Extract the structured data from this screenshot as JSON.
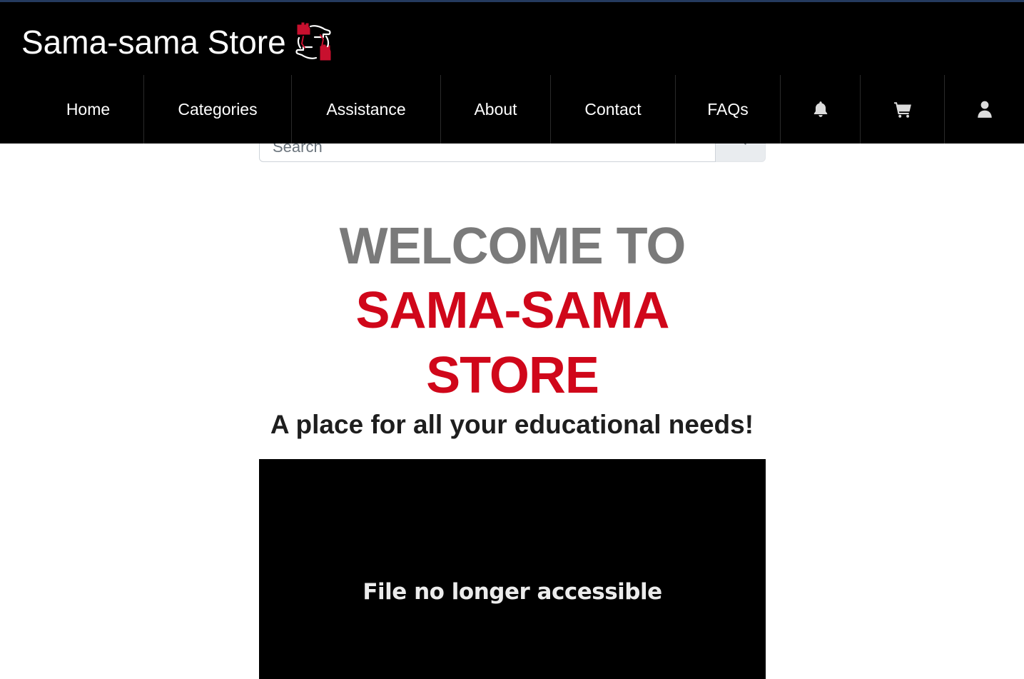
{
  "brand": {
    "name": "Sama-sama Store",
    "logo_icon": "hands-circle-logo-icon"
  },
  "nav": {
    "items": [
      {
        "label": "Home"
      },
      {
        "label": "Categories"
      },
      {
        "label": "Assistance"
      },
      {
        "label": "About"
      },
      {
        "label": "Contact"
      },
      {
        "label": "FAQs"
      }
    ],
    "icons": [
      "bell-icon",
      "cart-icon",
      "user-icon"
    ]
  },
  "search": {
    "placeholder": "Search",
    "button_icon": "search-icon"
  },
  "hero": {
    "welcome": "WELCOME TO",
    "store_line1": "SAMA-SAMA",
    "store_line2": "STORE",
    "tagline": "A place for all your educational needs!"
  },
  "media": {
    "message": "File no longer accessible"
  },
  "colors": {
    "header_bg": "#000000",
    "accent_red": "#d0071a",
    "welcome_gray": "#7a7a7a",
    "tagline_dark": "#1e1e1e"
  }
}
